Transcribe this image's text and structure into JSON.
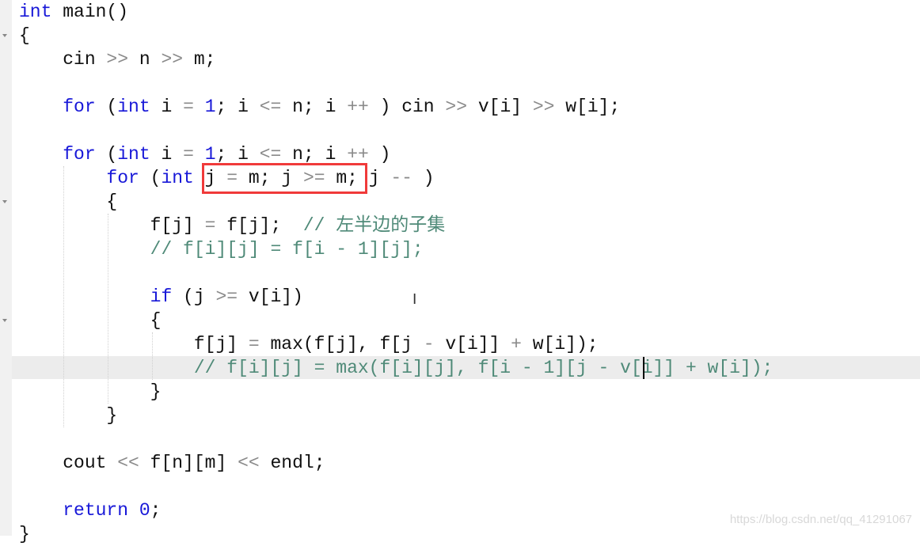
{
  "editor": {
    "lines": [
      [
        {
          "t": "int",
          "c": "k"
        },
        {
          "t": " main()"
        }
      ],
      [
        {
          "t": "{"
        }
      ],
      [
        {
          "t": "    cin "
        },
        {
          "t": ">>",
          "c": "o"
        },
        {
          "t": " n "
        },
        {
          "t": ">>",
          "c": "o"
        },
        {
          "t": " m;"
        }
      ],
      [],
      [
        {
          "t": "    "
        },
        {
          "t": "for",
          "c": "k"
        },
        {
          "t": " ("
        },
        {
          "t": "int",
          "c": "k"
        },
        {
          "t": " i "
        },
        {
          "t": "=",
          "c": "o"
        },
        {
          "t": " "
        },
        {
          "t": "1",
          "c": "n"
        },
        {
          "t": "; i "
        },
        {
          "t": "<=",
          "c": "o"
        },
        {
          "t": " n; i "
        },
        {
          "t": "++",
          "c": "o"
        },
        {
          "t": " ) cin "
        },
        {
          "t": ">>",
          "c": "o"
        },
        {
          "t": " v[i] "
        },
        {
          "t": ">>",
          "c": "o"
        },
        {
          "t": " w[i];"
        }
      ],
      [],
      [
        {
          "t": "    "
        },
        {
          "t": "for",
          "c": "k"
        },
        {
          "t": " ("
        },
        {
          "t": "int",
          "c": "k"
        },
        {
          "t": " i "
        },
        {
          "t": "=",
          "c": "o"
        },
        {
          "t": " "
        },
        {
          "t": "1",
          "c": "n"
        },
        {
          "t": "; i "
        },
        {
          "t": "<=",
          "c": "o"
        },
        {
          "t": " n; i "
        },
        {
          "t": "++",
          "c": "o"
        },
        {
          "t": " )"
        }
      ],
      [
        {
          "t": "        "
        },
        {
          "t": "for",
          "c": "k"
        },
        {
          "t": " ("
        },
        {
          "t": "int",
          "c": "k"
        },
        {
          "t": " j "
        },
        {
          "t": "=",
          "c": "o"
        },
        {
          "t": " m; j "
        },
        {
          "t": ">=",
          "c": "o"
        },
        {
          "t": " m; j "
        },
        {
          "t": "--",
          "c": "o"
        },
        {
          "t": " )"
        }
      ],
      [
        {
          "t": "        {"
        }
      ],
      [
        {
          "t": "            f[j] "
        },
        {
          "t": "=",
          "c": "o"
        },
        {
          "t": " f[j];  "
        },
        {
          "t": "// 左半边的子集",
          "c": "c"
        }
      ],
      [
        {
          "t": "            "
        },
        {
          "t": "// f[i][j] = f[i - 1][j];",
          "c": "c"
        }
      ],
      [],
      [
        {
          "t": "            "
        },
        {
          "t": "if",
          "c": "k"
        },
        {
          "t": " (j "
        },
        {
          "t": ">=",
          "c": "o"
        },
        {
          "t": " v[i])"
        }
      ],
      [
        {
          "t": "            {"
        }
      ],
      [
        {
          "t": "                f[j] "
        },
        {
          "t": "=",
          "c": "o"
        },
        {
          "t": " max(f[j], f[j "
        },
        {
          "t": "-",
          "c": "o"
        },
        {
          "t": " v[i]] "
        },
        {
          "t": "+",
          "c": "o"
        },
        {
          "t": " w[i]);"
        }
      ],
      [
        {
          "t": "                "
        },
        {
          "t": "// f[i][j] = max(f[i][j], f[i - 1][j - v[i]] + w[i]);",
          "c": "c"
        }
      ],
      [
        {
          "t": "            }"
        }
      ],
      [
        {
          "t": "        }"
        }
      ],
      [],
      [
        {
          "t": "    cout "
        },
        {
          "t": "<<",
          "c": "o"
        },
        {
          "t": " f[n][m] "
        },
        {
          "t": "<<",
          "c": "o"
        },
        {
          "t": " endl;"
        }
      ],
      [],
      [
        {
          "t": "    "
        },
        {
          "t": "return",
          "c": "k"
        },
        {
          "t": " "
        },
        {
          "t": "0",
          "c": "n"
        },
        {
          "t": ";"
        }
      ],
      [
        {
          "t": "}"
        }
      ]
    ],
    "highlighted_line": 16,
    "annotation": "red-box-around-loop-condition",
    "colors": {
      "keyword": "#1818d8",
      "operator": "#8a8a8a",
      "comment": "#4f8a78",
      "annotation": "#f03a3a"
    }
  },
  "watermark": "https://blog.csdn.net/qq_41291067"
}
